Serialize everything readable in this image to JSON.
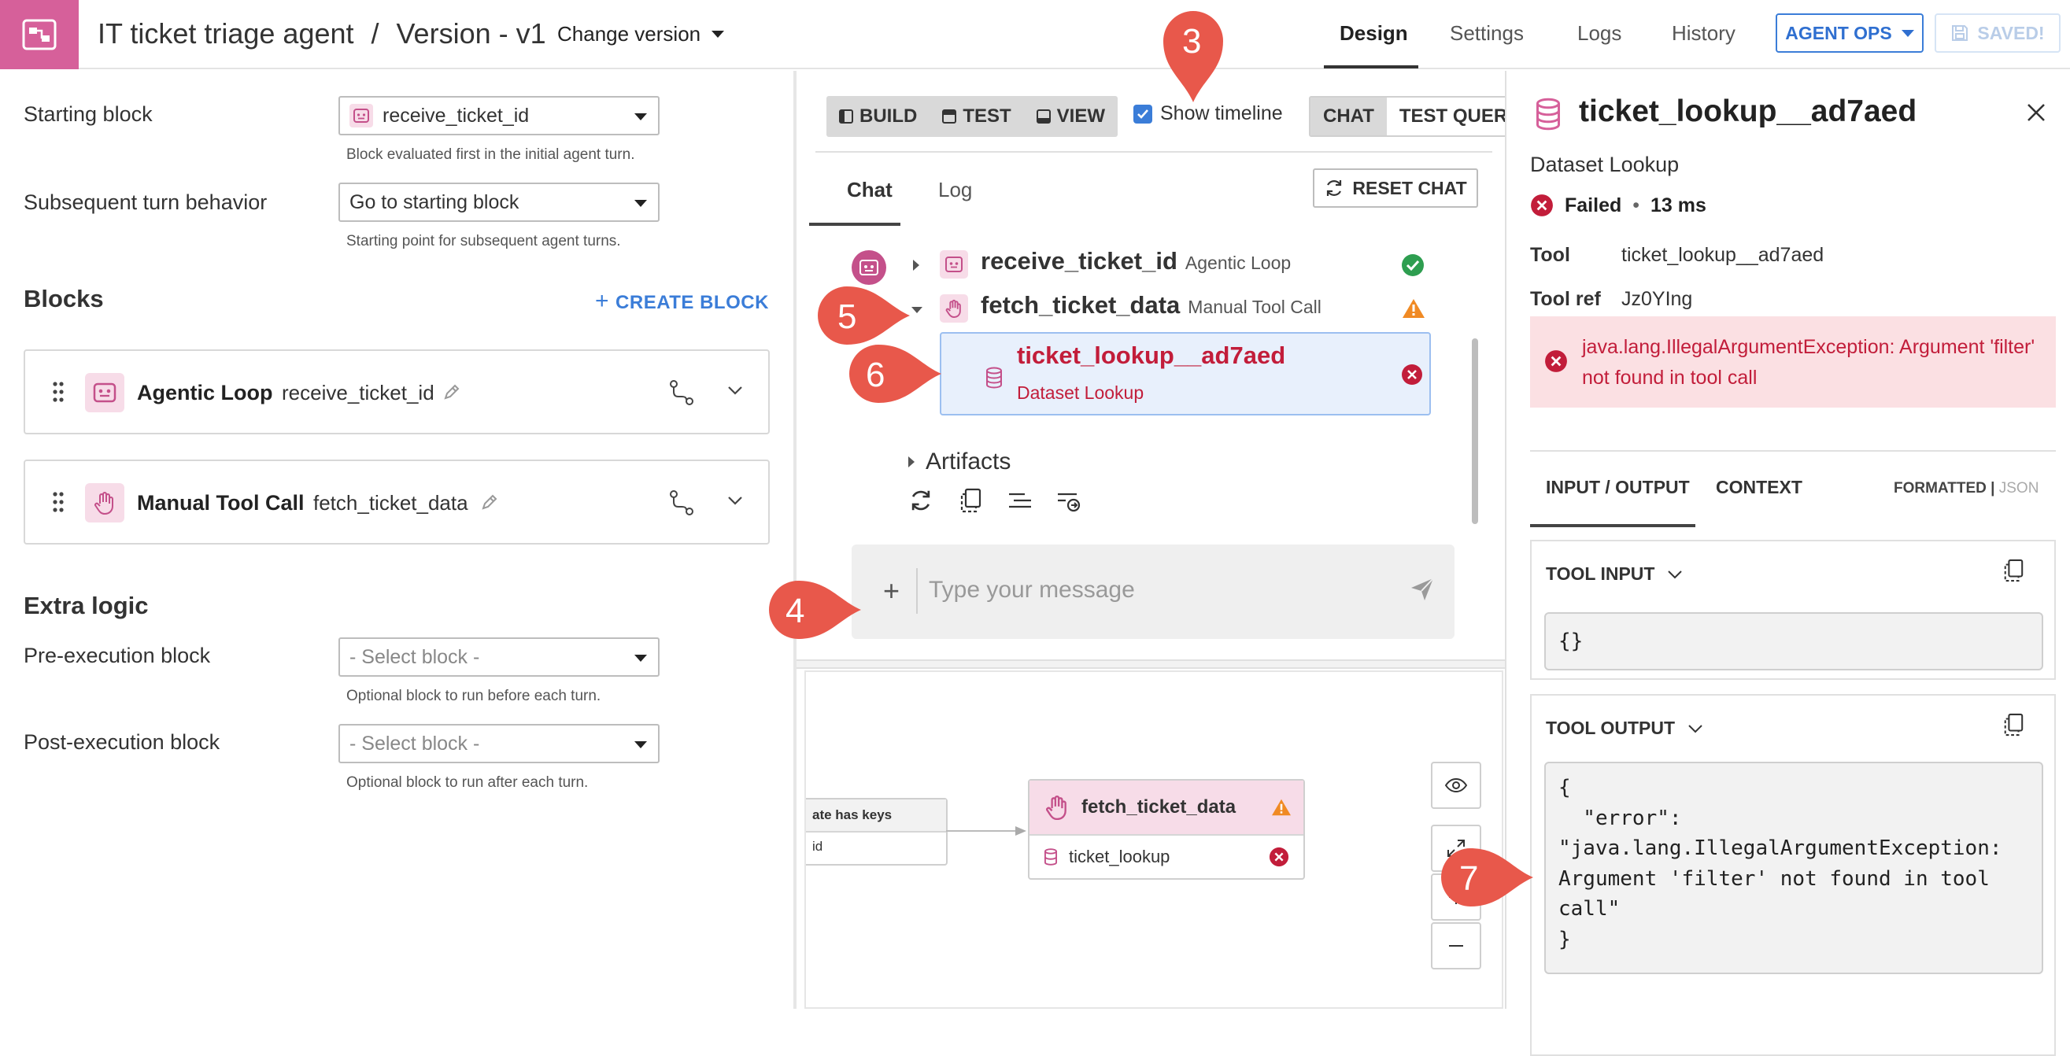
{
  "header": {
    "app_title": "IT ticket triage agent",
    "separator": "/",
    "version": "Version - v1",
    "change_version": "Change version",
    "tabs": [
      "Design",
      "Settings",
      "Logs",
      "History"
    ],
    "active_tab": "Design",
    "agent_ops": "AGENT OPS",
    "saved": "SAVED!"
  },
  "left": {
    "starting_block_label": "Starting block",
    "starting_block_value": "receive_ticket_id",
    "starting_block_hint": "Block evaluated first in the initial agent turn.",
    "subsequent_label": "Subsequent turn behavior",
    "subsequent_value": "Go to starting block",
    "subsequent_hint": "Starting point for subsequent agent turns.",
    "blocks_title": "Blocks",
    "create_block": "CREATE BLOCK",
    "blocks": [
      {
        "type": "Agentic Loop",
        "name": "receive_ticket_id"
      },
      {
        "type": "Manual Tool Call",
        "name": "fetch_ticket_data"
      }
    ],
    "extra_logic_title": "Extra logic",
    "pre_label": "Pre-execution block",
    "pre_value": "- Select block -",
    "pre_hint": "Optional block to run before each turn.",
    "post_label": "Post-execution block",
    "post_value": "- Select block -",
    "post_hint": "Optional block to run after each turn."
  },
  "middle": {
    "modes": [
      "BUILD",
      "TEST",
      "VIEW"
    ],
    "show_timeline": "Show timeline",
    "show_timeline_checked": true,
    "chat_tabs": [
      "CHAT",
      "TEST QUERY"
    ],
    "sub_tabs": [
      "Chat",
      "Log"
    ],
    "reset_chat": "RESET CHAT",
    "timeline": [
      {
        "name": "receive_ticket_id",
        "type": "Agentic Loop",
        "status": "success"
      },
      {
        "name": "fetch_ticket_data",
        "type": "Manual Tool Call",
        "status": "warning"
      }
    ],
    "tool_call": {
      "name": "ticket_lookup__ad7aed",
      "type": "Dataset Lookup",
      "status": "failed"
    },
    "artifacts": "Artifacts",
    "message_placeholder": "Type your message",
    "graph": {
      "node_a_title": "ate has keys",
      "node_a_body": "id",
      "node_b_title": "fetch_ticket_data",
      "node_b_tool": "ticket_lookup"
    }
  },
  "right": {
    "title": "ticket_lookup__ad7aed",
    "subtitle": "Dataset Lookup",
    "status": "Failed",
    "bullet": "•",
    "duration": "13 ms",
    "tool_label": "Tool",
    "tool_value": "ticket_lookup__ad7aed",
    "toolref_label": "Tool ref",
    "toolref_value": "Jz0YIng",
    "error": "java.lang.IllegalArgumentException: Argument 'filter' not found in tool call",
    "io_tabs": [
      "INPUT / OUTPUT",
      "CONTEXT"
    ],
    "formatted": "FORMATTED",
    "pipe": "|",
    "json": "JSON",
    "tool_input_label": "TOOL INPUT",
    "tool_input": "{}",
    "tool_output_label": "TOOL OUTPUT",
    "tool_output": "{\n  \"error\":\n\"java.lang.IllegalArgumentException:\nArgument 'filter' not found in tool\ncall\"\n}"
  },
  "callouts": [
    "3",
    "4",
    "5",
    "6",
    "7"
  ],
  "colors": {
    "accent": "#3b7dd8",
    "brand_pink": "#d6609a",
    "error_red": "#c21d3a",
    "success_green": "#2e9e50",
    "warning_orange": "#f08a24",
    "callout_red": "#e8584b"
  }
}
